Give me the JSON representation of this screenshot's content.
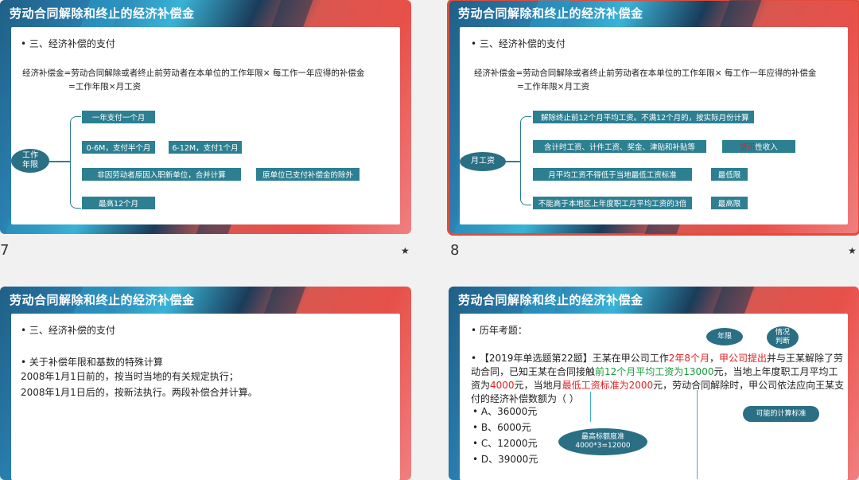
{
  "slide_title": "劳动合同解除和终止的经济补偿金",
  "slides": {
    "s1": {
      "number": "7",
      "section": "三、经济补偿的支付",
      "formula_line1": "经济补偿金=劳动合同解除或者终止前劳动者在本单位的工作年限× 每工作一年应得的补偿金",
      "formula_line2": "=工作年限×月工资",
      "oval": "工作\n年限",
      "boxes": {
        "b1": "一年支付一个月",
        "b2": "0-6M，支付半个月",
        "b3": "6-12M，支付1个月",
        "b4": "非因劳动者原因入职新单位，合并计算",
        "b5": "原单位已支付补偿金的除外",
        "b6": "最高12个月"
      }
    },
    "s2": {
      "number": "8",
      "section": "三、经济补偿的支付",
      "formula_line1": "经济补偿金=劳动合同解除或者终止前劳动者在本单位的工作年限× 每工作一年应得的补偿金",
      "formula_line2": "=工作年限×月工资",
      "oval": "月工资",
      "boxes": {
        "b1": "解除终止前12个月平均工资。不满12个月的，按实际月份计算",
        "b2": "含计时工资、计件工资、奖金、津贴和补贴等",
        "b3_red": "货币",
        "b3_rest": "性收入",
        "b4": "月平均工资不得低于当地最低工资标准",
        "b5": "最低限",
        "b6": "不能高于本地区上年度职工月平均工资的3倍",
        "b7": "最高限"
      }
    },
    "s3": {
      "section": "三、经济补偿的支付",
      "subsection": "关于补偿年限和基数的特殊计算",
      "line1": "2008年1月1日前的，按当时当地的有关规定执行；",
      "line2": "2008年1月1日后的，按新法执行。两段补偿合并计算。"
    },
    "s4": {
      "section": "历年考题：",
      "q_parts": {
        "p1": "【2019年单选题第22题】王某在甲公司工作",
        "p2_red": "2年8个月",
        "p3": "，",
        "p4_red": "甲公司提出",
        "p5": "并与王某解除了劳动合同，已知王某在合同接触",
        "p6_green": "前12个月平均工资为13000",
        "p7": "元，当地上年度职工月平均工资为",
        "p8_red": "4000",
        "p9": "元，当地月",
        "p10_red": "最低工资标准为2000",
        "p11": "元，劳动合同解除时，甲公司依法应向王某支付的经济补偿数额为（   ）"
      },
      "options": [
        "A、36000元",
        "B、6000元",
        "C、12000元",
        "D、39000元"
      ],
      "anno": {
        "nianxian": "年限",
        "qingkuang": "情况\n判断",
        "possible": "可能的计算标准",
        "max_label": "最高标额度准",
        "max_calc": "4000*3=12000"
      }
    }
  }
}
